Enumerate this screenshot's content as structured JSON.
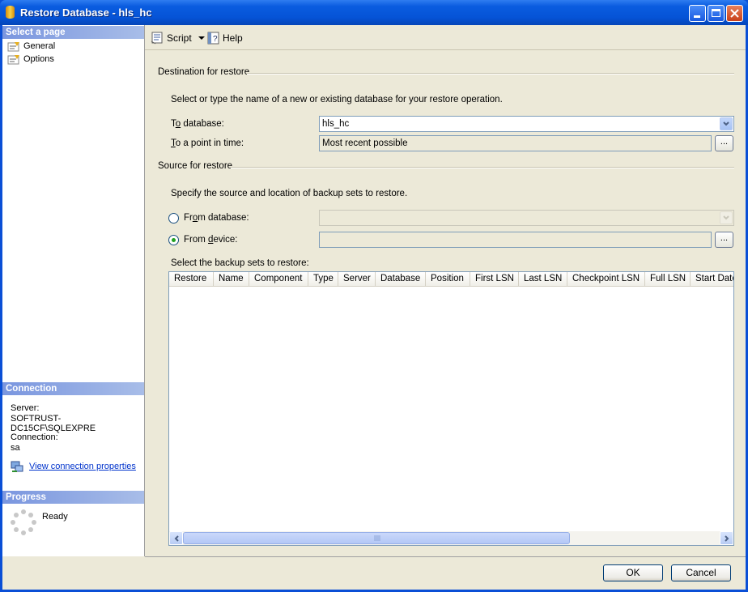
{
  "window": {
    "title": "Restore Database - hls_hc"
  },
  "left_panel": {
    "select_page_header": "Select a page",
    "pages": [
      {
        "label": "General"
      },
      {
        "label": "Options"
      }
    ],
    "connection_header": "Connection",
    "server_label": "Server:",
    "server_value": "SOFTRUST-DC15CF\\SQLEXPRE",
    "connection_label": "Connection:",
    "connection_value": "sa",
    "view_connection_link": "View connection properties",
    "progress_header": "Progress",
    "progress_status": "Ready"
  },
  "toolbar": {
    "script_label": "Script",
    "help_label": "Help"
  },
  "destination": {
    "group_label": "Destination for restore",
    "instruction": "Select or type the name of a new or existing database for your restore operation.",
    "to_database_prefix": "T",
    "to_database_mnemonic": "o",
    "to_database_suffix": " database:",
    "to_database_value": "hls_hc",
    "point_in_time_mnemonic": "T",
    "point_in_time_suffix": "o a point in time:",
    "point_in_time_value": "Most recent possible",
    "browse_label": "..."
  },
  "source": {
    "group_label": "Source for restore",
    "instruction": "Specify the source and location of backup sets to restore.",
    "from_database_prefix": "Fr",
    "from_database_mnemonic": "o",
    "from_database_suffix": "m database:",
    "from_database_value": "",
    "from_device_prefix": "From ",
    "from_device_mnemonic": "d",
    "from_device_suffix": "evice:",
    "from_device_value": "",
    "selected_option": "From device",
    "browse_label": "...",
    "backup_sets_label": "Select the backup sets to restore:",
    "columns": [
      "Restore",
      "Name",
      "Component",
      "Type",
      "Server",
      "Database",
      "Position",
      "First LSN",
      "Last LSN",
      "Checkpoint LSN",
      "Full LSN",
      "Start Date"
    ],
    "rows": []
  },
  "buttons": {
    "ok": "OK",
    "cancel": "Cancel"
  },
  "colors": {
    "titlebar": "#0553d6",
    "section_header": "#7a96df",
    "dialog_bg": "#ece9d8",
    "link": "#0033cc",
    "radio_selected": "#21a121"
  }
}
